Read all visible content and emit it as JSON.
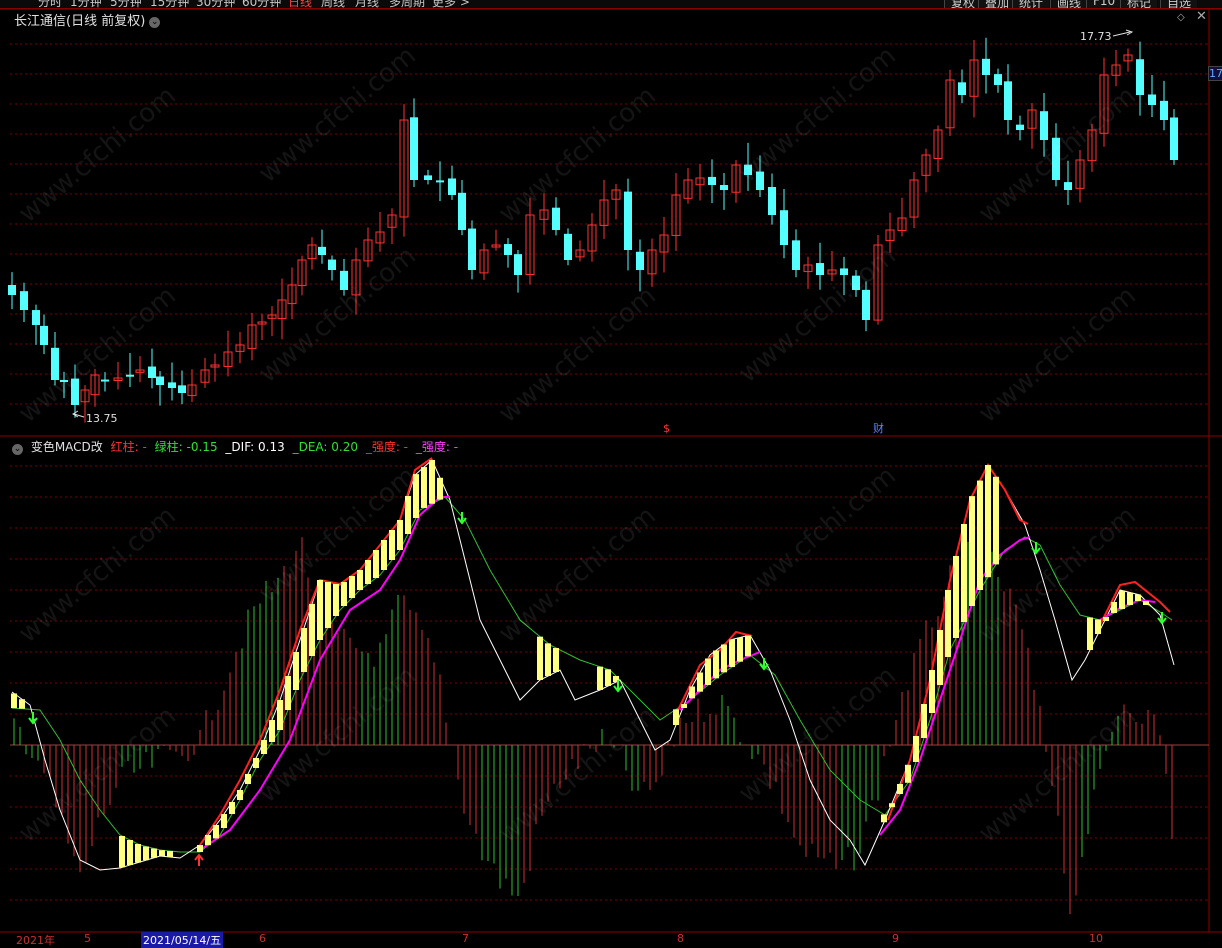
{
  "toolbar": {
    "periods": [
      "分时",
      "1分钟",
      "5分钟",
      "15分钟",
      "30分钟",
      "60分钟",
      "日线",
      "周线",
      "月线",
      "多周期",
      "更多 >"
    ],
    "active_period": "日线",
    "right_buttons": [
      "复权",
      "叠加",
      "统计",
      "画线",
      "F10",
      "标记",
      "自选"
    ]
  },
  "price_panel": {
    "title": "长江通信(日线 前复权)",
    "high_label": "17.73",
    "low_label": "13.75",
    "right_price": "17",
    "event_marks": [
      "$",
      "财"
    ]
  },
  "indicator_panel": {
    "name": "变色MACD改",
    "red_bar": "红柱: -",
    "green_bar": "绿柱: -0.15",
    "dif": "_DIF: 0.13",
    "dea": "_DEA: 0.20",
    "strength1": "_强度: -",
    "strength2": "_强度: -"
  },
  "axis": {
    "labels": [
      "2021年",
      "5",
      "6",
      "7",
      "8",
      "9",
      "10"
    ],
    "cursor_date": "2021/05/14/五"
  },
  "watermark": "www.cfchi.com",
  "colors": {
    "up": "#ff3232",
    "down": "#54ffff",
    "grid": "#7a0000",
    "dif": "#ffffff",
    "dea_up": "#ff00ff",
    "bar_yellow": "#ffff80",
    "hist_red": "#d03030",
    "hist_green": "#30c030"
  }
}
